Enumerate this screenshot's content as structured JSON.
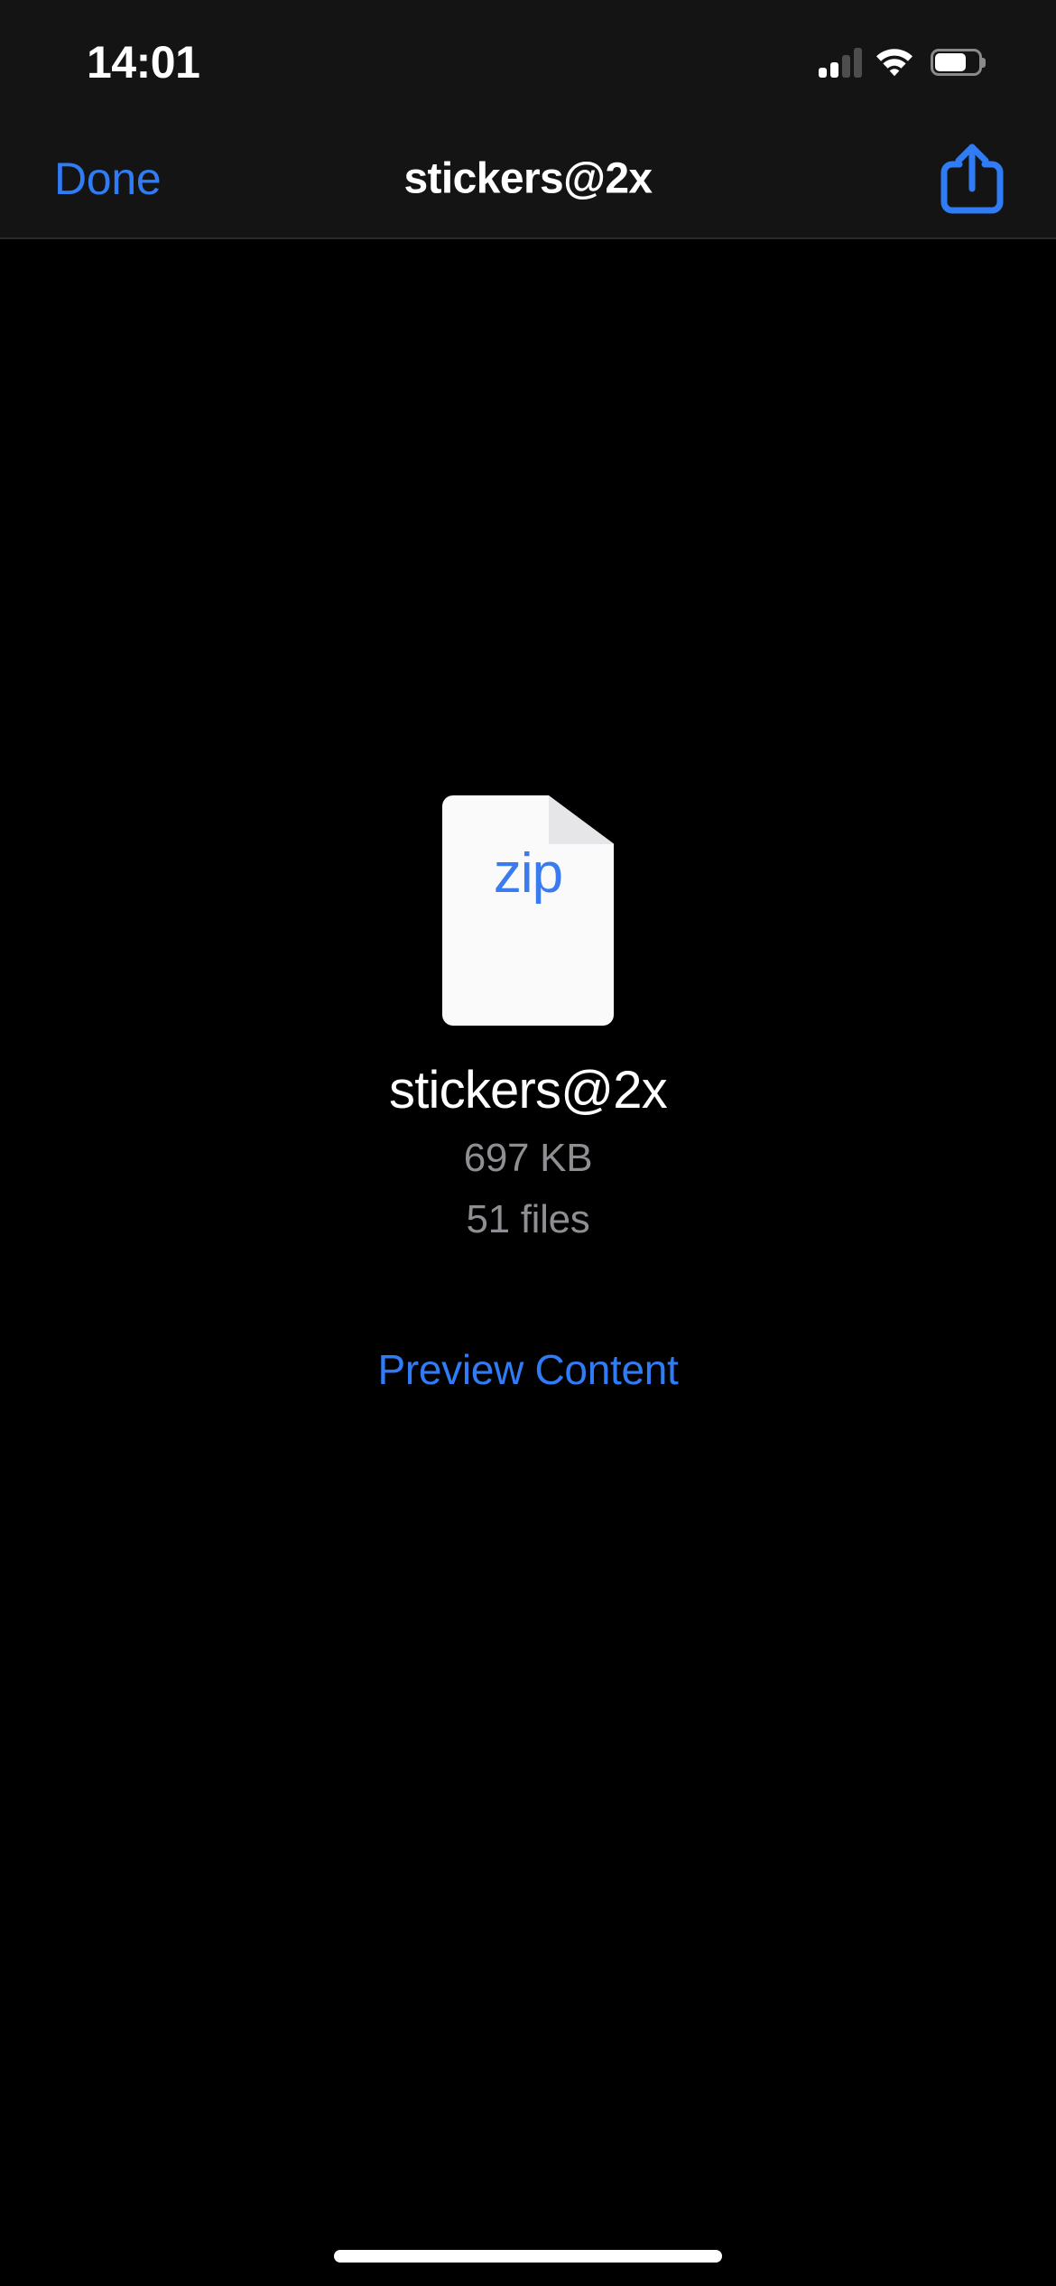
{
  "status_bar": {
    "time": "14:01",
    "signal_icon": "cellular-signal-icon",
    "signal_bars_filled": 2,
    "signal_bars_total": 4,
    "wifi_icon": "wifi-icon",
    "wifi_strength": 3,
    "battery_icon": "battery-icon",
    "battery_percent": 70
  },
  "nav_bar": {
    "done_label": "Done",
    "title": "stickers@2x",
    "share_icon": "share-icon"
  },
  "file": {
    "icon_extension": "zip",
    "icon_name": "zip-document-icon",
    "name": "stickers@2x",
    "size": "697 KB",
    "count": "51 files"
  },
  "actions": {
    "preview_label": "Preview Content"
  },
  "colors": {
    "accent_blue": "#2f7cf6",
    "background": "#000000",
    "bar_background": "#141414",
    "secondary_text": "#8e8e93",
    "primary_text": "#ffffff",
    "zip_text": "#3b7bf0"
  },
  "home_indicator": "home-indicator"
}
